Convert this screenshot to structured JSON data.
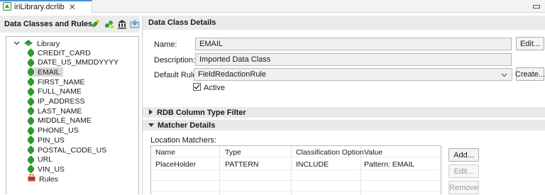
{
  "editor_tab": {
    "title": "iriLibrary.dcrlib"
  },
  "left_panel": {
    "title": "Data Classes and Rules",
    "toolbar_icons": [
      "add-data-class-icon",
      "add-multiple-classes-icon",
      "library-icon",
      "import-icon",
      "delete-icon"
    ],
    "tree": {
      "root": "Library",
      "items": [
        "CREDIT_CARD",
        "DATE_US_MMDDYYYY",
        "EMAIL",
        "FIRST_NAME",
        "FULL_NAME",
        "IP_ADDRESS",
        "LAST_NAME",
        "MIDDLE_NAME",
        "PHONE_US",
        "PIN_US",
        "POSTAL_CODE_US",
        "URL",
        "VIN_US"
      ],
      "selected": "EMAIL",
      "rules": "Rules"
    }
  },
  "details": {
    "title": "Data Class Details",
    "name_label": "Name:",
    "name_value": "EMAIL",
    "edit_button": "Edit...",
    "description_label": "Description:",
    "description_value": "Imported Data Class",
    "default_rule_label": "Default Rule:",
    "default_rule_value": "FieldRedactionRule",
    "create_button": "Create...",
    "active_label": "Active",
    "active_checked": true
  },
  "rdb_section": {
    "title": "RDB Column Type Filter"
  },
  "matcher_section": {
    "title": "Matcher Details",
    "location_label": "Location Matchers:",
    "columns": [
      "Name",
      "Type",
      "Classification Option",
      "Value"
    ],
    "rows": [
      [
        "PlaceHolder",
        "PATTERN",
        "INCLUDE",
        "Pattern: EMAIL"
      ]
    ],
    "add_button": "Add...",
    "edit_button": "Edit...",
    "remove_button": "Remove"
  },
  "colors": {
    "accent": "#4a90d9",
    "leaf_green": "#2e9a2e",
    "delete_red": "#d23b3b"
  }
}
